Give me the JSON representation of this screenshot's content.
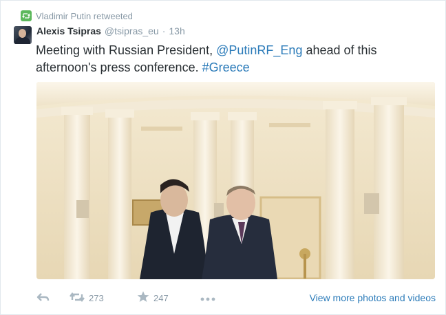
{
  "retweet_bar": {
    "icon": "retweet-icon",
    "text": "Vladimir Putin retweeted"
  },
  "tweet": {
    "author_name": "Alexis Tsipras",
    "author_handle": "@tsipras_eu",
    "separator": "·",
    "time": "13h",
    "text_part1": "Meeting with Russian President, ",
    "mention": "@PutinRF_Eng",
    "text_part2": " ahead of this afternoon's press conference. ",
    "hashtag": "#Greece"
  },
  "actions": {
    "reply_icon": "reply-icon",
    "retweet_icon": "retweet-icon",
    "retweet_count": "273",
    "favorite_icon": "star-icon",
    "favorite_count": "247",
    "more_icon": "more-dots-icon",
    "view_more": "View more photos and videos"
  },
  "colors": {
    "link": "#2b7bb9",
    "muted": "#8899a6",
    "text": "#292f33",
    "retweet_badge": "#5cb85c"
  }
}
